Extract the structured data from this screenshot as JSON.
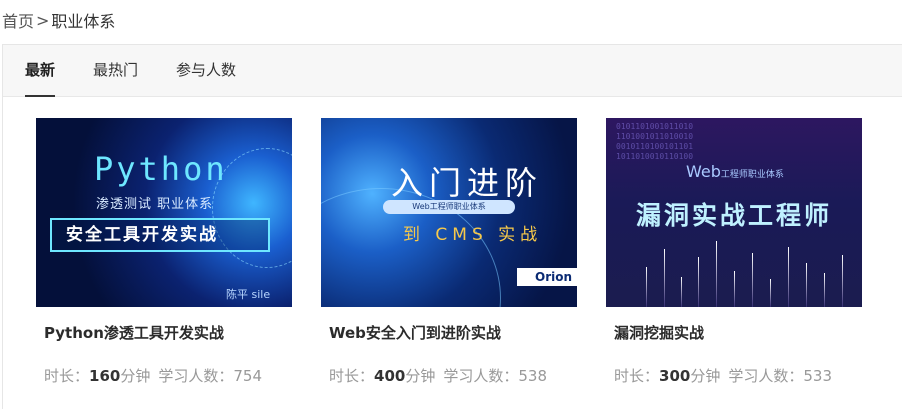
{
  "breadcrumb": {
    "home": "首页",
    "separator": ">",
    "current": "职业体系"
  },
  "tabs": [
    {
      "label": "最新",
      "active": true
    },
    {
      "label": "最热门",
      "active": false
    },
    {
      "label": "参与人数",
      "active": false
    }
  ],
  "courses": [
    {
      "title": "Python渗透工具开发实战",
      "duration_label": "时长：",
      "duration_value": "160",
      "duration_unit": "分钟",
      "learners_label": "学习人数：",
      "learners_value": "754",
      "thumb": {
        "headline": "Python",
        "subheadline": "渗透测试 职业体系",
        "banner": "安全工具开发实战",
        "author": "陈平 sile"
      }
    },
    {
      "title": "Web安全入门到进阶实战",
      "duration_label": "时长：",
      "duration_value": "400",
      "duration_unit": "分钟",
      "learners_label": "学习人数：",
      "learners_value": "538",
      "thumb": {
        "headline": "入门进阶",
        "pill": "Web工程师职业体系",
        "subheadline": "到 CMS 实战",
        "brand": "Orion"
      }
    },
    {
      "title": "漏洞挖掘实战",
      "duration_label": "时长：",
      "duration_value": "300",
      "duration_unit": "分钟",
      "learners_label": "学习人数：",
      "learners_value": "533",
      "thumb": {
        "prefix": "Web",
        "prefix_small": "工程师职业体系",
        "headline": "漏洞实战工程师"
      }
    }
  ],
  "colors": {
    "text": "#333333",
    "muted": "#999999",
    "tabbar_bg": "#f7f7f7",
    "accent_cyan": "#6ee7ff",
    "accent_gold": "#f7c94a"
  }
}
